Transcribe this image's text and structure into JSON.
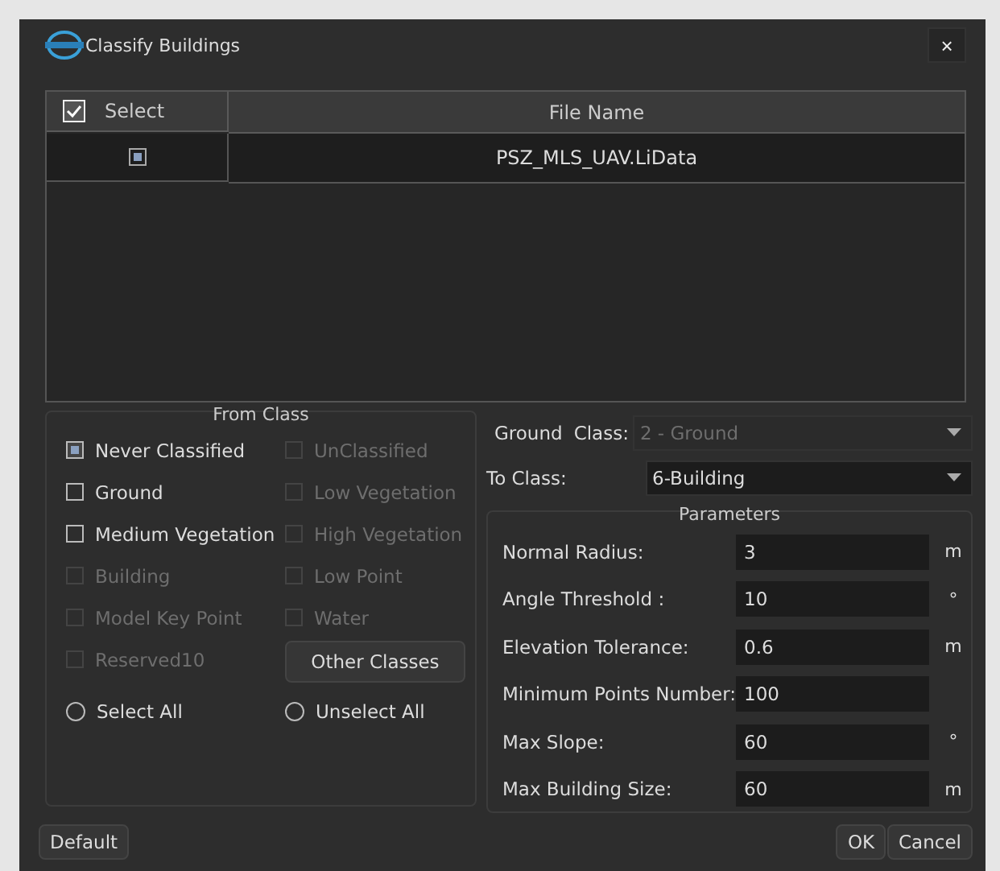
{
  "window": {
    "title": "Classify Buildings",
    "close": "×"
  },
  "table": {
    "select_all_checked": true,
    "columns": [
      "Select",
      "File Name"
    ],
    "rows": [
      {
        "checked": true,
        "file_name": "PSZ_MLS_UAV.LiData"
      }
    ]
  },
  "from_class": {
    "title": "From Class",
    "items": [
      {
        "kind": "checkbox",
        "label": "Never Classified",
        "checked": true,
        "disabled": false
      },
      {
        "kind": "checkbox",
        "label": "UnClassified",
        "checked": false,
        "disabled": true
      },
      {
        "kind": "checkbox",
        "label": "Ground",
        "checked": false,
        "disabled": false
      },
      {
        "kind": "checkbox",
        "label": "Low Vegetation",
        "checked": false,
        "disabled": true
      },
      {
        "kind": "checkbox",
        "label": "Medium Vegetation",
        "checked": false,
        "disabled": false
      },
      {
        "kind": "checkbox",
        "label": "High Vegetation",
        "checked": false,
        "disabled": true
      },
      {
        "kind": "checkbox",
        "label": "Building",
        "checked": false,
        "disabled": true
      },
      {
        "kind": "checkbox",
        "label": "Low Point",
        "checked": false,
        "disabled": true
      },
      {
        "kind": "checkbox",
        "label": "Model Key Point",
        "checked": false,
        "disabled": true
      },
      {
        "kind": "checkbox",
        "label": "Water",
        "checked": false,
        "disabled": true
      },
      {
        "kind": "checkbox",
        "label": "Reserved10",
        "checked": false,
        "disabled": true
      },
      {
        "kind": "button",
        "label": "Other Classes"
      },
      {
        "kind": "radio",
        "label": "Select All",
        "checked": false,
        "disabled": false
      },
      {
        "kind": "radio",
        "label": "Unselect All",
        "checked": false,
        "disabled": false
      }
    ]
  },
  "ground_class": {
    "label": "Ground",
    "label_2": "Class:",
    "value": "2 - Ground",
    "disabled": true
  },
  "to_class": {
    "label": "To Class:",
    "value": "6-Building",
    "disabled": false
  },
  "parameters": {
    "title": "Parameters",
    "rows": [
      {
        "label": "Normal Radius:",
        "value": "3",
        "unit": "m"
      },
      {
        "label": "Angle Threshold :",
        "value": "10",
        "unit": "°"
      },
      {
        "label": "Elevation Tolerance:",
        "value": "0.6",
        "unit": "m"
      },
      {
        "label": "Minimum Points Number:",
        "value": "100"
      },
      {
        "label": "Max Slope:",
        "value": "60",
        "unit": "°"
      },
      {
        "label": "Max Building Size:",
        "value": "60",
        "unit": "m"
      }
    ]
  },
  "buttons": {
    "default": "Default",
    "ok": "OK",
    "cancel": "Cancel"
  }
}
